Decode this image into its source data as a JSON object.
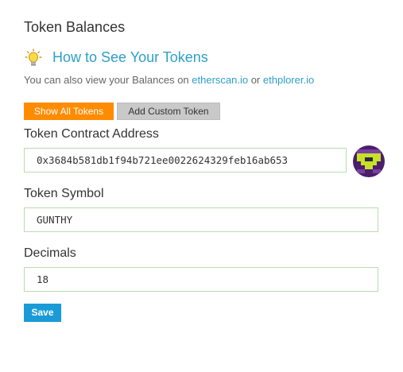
{
  "section": {
    "title": "Token Balances",
    "howto_title": "How to See Your Tokens",
    "view_prefix": "You can also view your Balances on ",
    "link_etherscan": "etherscan.io",
    "view_or": " or ",
    "link_ethplorer": "ethplorer.io"
  },
  "buttons": {
    "show_all": "Show All Tokens",
    "add_custom": "Add Custom Token",
    "save": "Save"
  },
  "form": {
    "address_label": "Token Contract Address",
    "address_value": "0x3684b581db1f94b721ee0022624329feb16ab653",
    "symbol_label": "Token Symbol",
    "symbol_value": "GUNTHY",
    "decimals_label": "Decimals",
    "decimals_value": "18"
  },
  "icons": {
    "bulb": "lightbulb-icon",
    "identicon": "address-identicon"
  },
  "colors": {
    "link": "#2e9fc9",
    "show_all_bg": "#ff8c00",
    "save_bg": "#1a9bd7",
    "field_border": "#b9dcb0"
  }
}
